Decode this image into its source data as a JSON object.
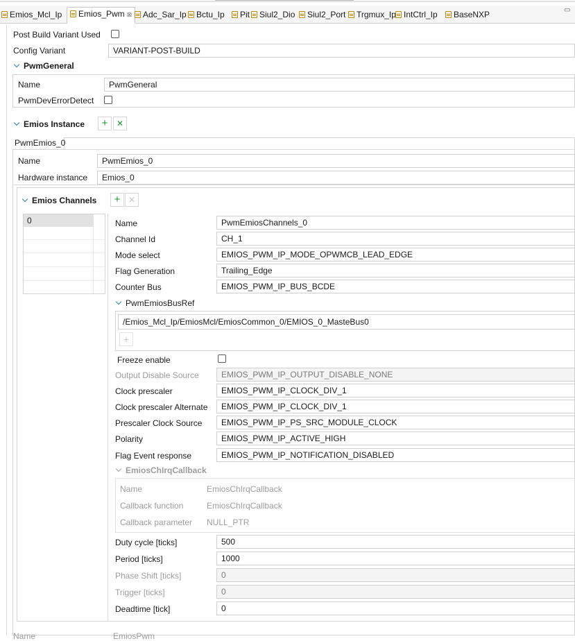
{
  "tabs": [
    {
      "label": "Emios_Mcl_Ip",
      "active": false
    },
    {
      "label": "Emios_Pwm",
      "active": true,
      "close": "⊠"
    },
    {
      "label": "Adc_Sar_Ip",
      "active": false
    },
    {
      "label": "Bctu_Ip",
      "active": false
    },
    {
      "label": "Pit",
      "active": false
    },
    {
      "label": "Siul2_Dio",
      "active": false
    },
    {
      "label": "Siul2_Port",
      "active": false
    },
    {
      "label": "Trgmux_Ip",
      "active": false
    },
    {
      "label": "IntCtrl_Ip",
      "active": false
    },
    {
      "label": "BaseNXP",
      "active": false
    }
  ],
  "top": {
    "pbvu_label": "Post Build Variant Used",
    "config_variant_label": "Config Variant",
    "config_variant_value": "VARIANT-POST-BUILD"
  },
  "pwm_general": {
    "title": "PwmGeneral",
    "name_label": "Name",
    "name_value": "PwmGeneral",
    "dev_error_label": "PwmDevErrorDetect"
  },
  "emios_instance": {
    "title": "Emios Instance",
    "tab": "PwmEmios_0",
    "name_label": "Name",
    "name_value": "PwmEmios_0",
    "hw_label": "Hardware instance",
    "hw_value": "Emios_0"
  },
  "channels": {
    "title": "Emios Channels",
    "list": [
      "0"
    ],
    "name_label": "Name",
    "name_value": "PwmEmiosChannels_0",
    "chid_label": "Channel Id",
    "chid_value": "CH_1",
    "mode_label": "Mode select",
    "mode_value": "EMIOS_PWM_IP_MODE_OPWMCB_LEAD_EDGE",
    "flag_label": "Flag Generation",
    "flag_value": "Trailing_Edge",
    "bus_label": "Counter Bus",
    "bus_value": "EMIOS_PWM_IP_BUS_BCDE",
    "busref_title": "PwmEmiosBusRef",
    "busref_value": "/Emios_Mcl_Ip/EmiosMcl/EmiosCommon_0/EMIOS_0_MasteBus0",
    "freeze_label": "Freeze enable",
    "ods_label": "Output Disable Source",
    "ods_value": "EMIOS_PWM_IP_OUTPUT_DISABLE_NONE",
    "cp_label": "Clock prescaler",
    "cp_value": "EMIOS_PWM_IP_CLOCK_DIV_1",
    "cpa_label": "Clock prescaler Alternate",
    "cpa_value": "EMIOS_PWM_IP_CLOCK_DIV_1",
    "pcs_label": "Prescaler Clock Source",
    "pcs_value": "EMIOS_PWM_IP_PS_SRC_MODULE_CLOCK",
    "pol_label": "Polarity",
    "pol_value": "EMIOS_PWM_IP_ACTIVE_HIGH",
    "fer_label": "Flag Event response",
    "fer_value": "EMIOS_PWM_IP_NOTIFICATION_DISABLED",
    "irq_title": "EmiosChIrqCallback",
    "irq_name_label": "Name",
    "irq_name_value": "EmiosChIrqCallback",
    "irq_fn_label": "Callback function",
    "irq_fn_value": "EmiosChIrqCallback",
    "irq_param_label": "Callback parameter",
    "irq_param_value": "NULL_PTR",
    "duty_label": "Duty cycle [ticks]",
    "duty_value": "500",
    "period_label": "Period [ticks]",
    "period_value": "1000",
    "phase_label": "Phase Shift [ticks]",
    "phase_value": "0",
    "trig_label": "Trigger [ticks]",
    "trig_value": "0",
    "dead_label": "Deadtime [tick]",
    "dead_value": "0"
  },
  "bottom": {
    "name_label": "Name",
    "name_value": "EmiosPwm"
  }
}
